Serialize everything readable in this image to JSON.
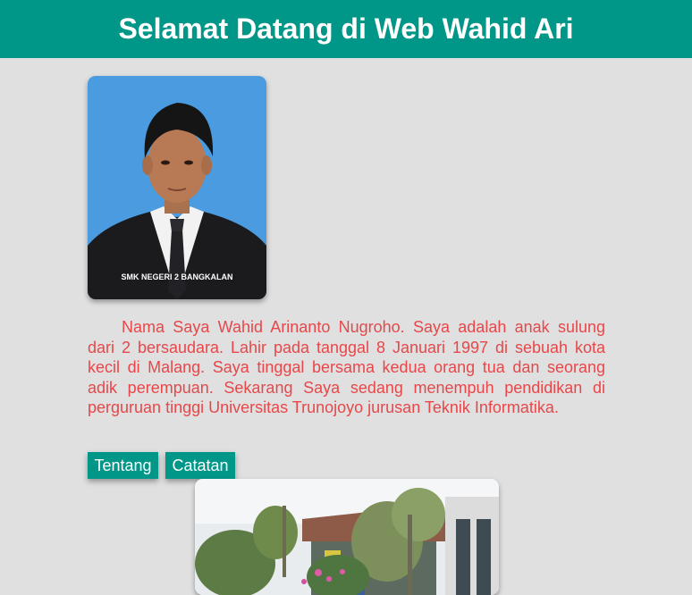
{
  "header": {
    "title": "Selamat Datang di Web Wahid Ari",
    "background": "#009688"
  },
  "profile_photo": {
    "caption": "SMK NEGERI 2 BANGKALAN"
  },
  "bio": {
    "text": "Nama Saya Wahid Arinanto Nugroho. Saya adalah anak sulung dari 2 bersaudara. Lahir pada tanggal 8 Januari 1997 di sebuah kota kecil di Malang. Saya tinggal bersama kedua orang tua dan seorang adik perempuan. Sekarang Saya sedang menempuh pendidikan di perguruan tinggi Universitas Trunojoyo jurusan Teknik Informatika.",
    "color": "#e8474a"
  },
  "nav": {
    "tentang_label": "Tentang",
    "catatan_label": "Catatan"
  },
  "colors": {
    "page_background": "#e0e0e0",
    "accent": "#009688"
  }
}
